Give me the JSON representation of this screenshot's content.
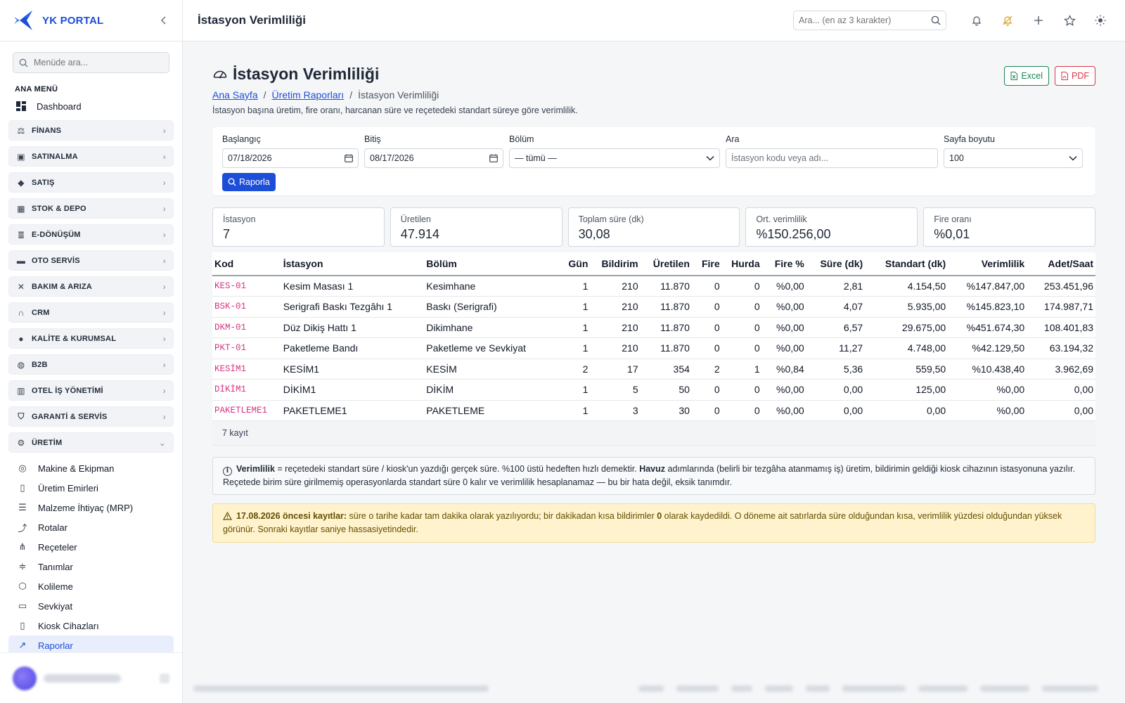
{
  "brand": {
    "name": "YK PORTAL"
  },
  "sidebar": {
    "search_placeholder": "Menüde ara...",
    "section_title": "ANA MENÜ",
    "dashboard_label": "Dashboard",
    "groups": [
      {
        "label": "FİNANS",
        "icon": "finance-icon"
      },
      {
        "label": "SATINALMA",
        "icon": "shopping-bag-icon"
      },
      {
        "label": "SATIŞ",
        "icon": "tag-icon"
      },
      {
        "label": "STOK & DEPO",
        "icon": "box-icon"
      },
      {
        "label": "E-DÖNÜŞÜM",
        "icon": "receipt-icon"
      },
      {
        "label": "OTO SERVİS",
        "icon": "car-icon"
      },
      {
        "label": "BAKIM & ARIZA",
        "icon": "tools-icon"
      },
      {
        "label": "CRM",
        "icon": "headset-icon"
      },
      {
        "label": "KALİTE & KURUMSAL",
        "icon": "badge-check-icon"
      },
      {
        "label": "B2B",
        "icon": "globe-icon"
      },
      {
        "label": "OTEL İŞ YÖNETİMİ",
        "icon": "building-icon"
      },
      {
        "label": "GARANTİ & SERVİS",
        "icon": "shield-icon"
      },
      {
        "label": "ÜRETİM",
        "icon": "gear-icon"
      }
    ],
    "uretim_items": [
      {
        "label": "Makine & Ekipman",
        "icon": "machine-icon"
      },
      {
        "label": "Üretim Emirleri",
        "icon": "clipboard-icon"
      },
      {
        "label": "Malzeme İhtiyaç (MRP)",
        "icon": "clipboard-list-icon"
      },
      {
        "label": "Rotalar",
        "icon": "signpost-icon"
      },
      {
        "label": "Reçeteler",
        "icon": "hierarchy-icon"
      },
      {
        "label": "Tanımlar",
        "icon": "sliders-icon"
      },
      {
        "label": "Kolileme",
        "icon": "package-icon"
      },
      {
        "label": "Sevkiyat",
        "icon": "truck-icon"
      },
      {
        "label": "Kiosk Cihazları",
        "icon": "tablet-icon"
      },
      {
        "label": "Raporlar",
        "icon": "chart-line-icon"
      }
    ]
  },
  "topbar": {
    "title": "İstasyon Verimliliği",
    "search_placeholder": "Ara... (en az 3 karakter)"
  },
  "page": {
    "title": "İstasyon Verimliliği",
    "breadcrumb": [
      "Ana Sayfa",
      "Üretim Raporları",
      "İstasyon Verimliliği"
    ],
    "description": "İstasyon başına üretim, fire oranı, harcanan süre ve reçetedeki standart süreye göre verimlilik.",
    "excel_label": "Excel",
    "pdf_label": "PDF"
  },
  "filters": {
    "start_label": "Başlangıç",
    "start_value": "07/18/2026",
    "end_label": "Bitiş",
    "end_value": "08/17/2026",
    "dept_label": "Bölüm",
    "dept_value": "— tümü —",
    "search_label": "Ara",
    "search_placeholder": "İstasyon kodu veya adı...",
    "pagesize_label": "Sayfa boyutu",
    "pagesize_value": "100",
    "submit_label": "Raporla"
  },
  "stats": [
    {
      "label": "İstasyon",
      "value": "7"
    },
    {
      "label": "Üretilen",
      "value": "47.914"
    },
    {
      "label": "Toplam süre (dk)",
      "value": "30,08"
    },
    {
      "label": "Ort. verimlilik",
      "value": "%150.256,00"
    },
    {
      "label": "Fire oranı",
      "value": "%0,01"
    }
  ],
  "table": {
    "headers": [
      "Kod",
      "İstasyon",
      "Bölüm",
      "Gün",
      "Bildirim",
      "Üretilen",
      "Fire",
      "Hurda",
      "Fire %",
      "Süre (dk)",
      "Standart (dk)",
      "Verimlilik",
      "Adet/Saat"
    ],
    "rows": [
      [
        "KES-01",
        "Kesim Masası 1",
        "Kesimhane",
        "1",
        "210",
        "11.870",
        "0",
        "0",
        "%0,00",
        "2,81",
        "4.154,50",
        "%147.847,00",
        "253.451,96"
      ],
      [
        "BSK-01",
        "Serigrafi Baskı Tezgâhı 1",
        "Baskı (Serigrafi)",
        "1",
        "210",
        "11.870",
        "0",
        "0",
        "%0,00",
        "4,07",
        "5.935,00",
        "%145.823,10",
        "174.987,71"
      ],
      [
        "DKM-01",
        "Düz Dikiş Hattı 1",
        "Dikimhane",
        "1",
        "210",
        "11.870",
        "0",
        "0",
        "%0,00",
        "6,57",
        "29.675,00",
        "%451.674,30",
        "108.401,83"
      ],
      [
        "PKT-01",
        "Paketleme Bandı",
        "Paketleme ve Sevkiyat",
        "1",
        "210",
        "11.870",
        "0",
        "0",
        "%0,00",
        "11,27",
        "4.748,00",
        "%42.129,50",
        "63.194,32"
      ],
      [
        "KESİM1",
        "KESİM1",
        "KESİM",
        "2",
        "17",
        "354",
        "2",
        "1",
        "%0,84",
        "5,36",
        "559,50",
        "%10.438,40",
        "3.962,69"
      ],
      [
        "DİKİM1",
        "DİKİM1",
        "DİKİM",
        "1",
        "5",
        "50",
        "0",
        "0",
        "%0,00",
        "0,00",
        "125,00",
        "%0,00",
        "0,00"
      ],
      [
        "PAKETLEME1",
        "PAKETLEME1",
        "PAKETLEME",
        "1",
        "3",
        "30",
        "0",
        "0",
        "%0,00",
        "0,00",
        "0,00",
        "%0,00",
        "0,00"
      ]
    ],
    "footer": "7 kayıt"
  },
  "notes": {
    "info_bold1": "Verimlilik",
    "info_text1": " = reçetedeki standart süre / kiosk'un yazdığı gerçek süre. %100 üstü hedeften hızlı demektir. ",
    "info_bold2": "Havuz",
    "info_text2": " adımlarında (belirli bir tezgâha atanmamış iş) üretim, bildirimin geldiği kiosk cihazının istasyonuna yazılır. Reçetede birim süre girilmemiş operasyonlarda standart süre 0 kalır ve verimlilik hesaplanamaz — bu bir hata değil, eksik tanımdır.",
    "warn_bold1": "17.08.2026 öncesi kayıtlar:",
    "warn_text1": " süre o tarihe kadar tam dakika olarak yazılıyordu; bir dakikadan kısa bildirimler ",
    "warn_bold2": "0",
    "warn_text2": " olarak kaydedildi. O döneme ait satırlarda süre olduğundan kısa, verimlilik yüzdesi olduğundan yüksek görünür. Sonraki kayıtlar saniye hassasiyetindedir."
  },
  "colors": {
    "primary": "#1d4ed8",
    "code": "#d63384",
    "excel": "#198754",
    "pdf": "#dc3545",
    "warning_bg": "#fff3cd"
  }
}
